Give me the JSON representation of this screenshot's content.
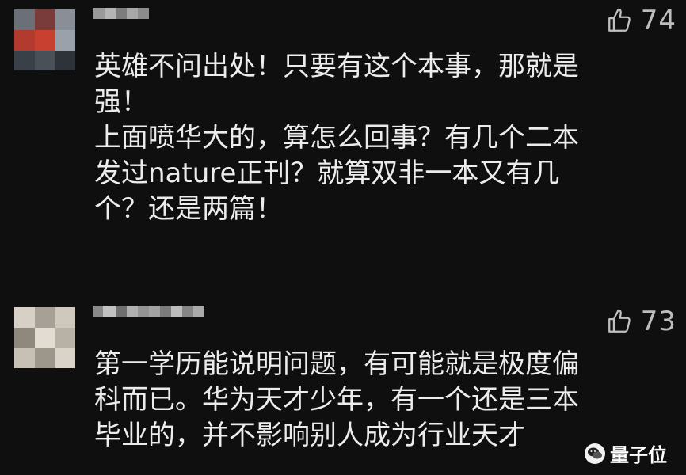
{
  "comments": [
    {
      "likes": "74",
      "lines": [
        "英雄不问出处！只要有这个本事，那就是",
        "强！",
        "上面喷华大的，算怎么回事？有几个二本",
        "发过nature正刊？就算双非一本又有几",
        "个？还是两篇！"
      ]
    },
    {
      "likes": "73",
      "lines": [
        "第一学历能说明问题，有可能就是极度偏",
        "科而已。华为天才少年，有一个还是三本",
        "毕业的，并不影响别人成为行业天才"
      ]
    }
  ],
  "watermark": {
    "label": "量子位"
  },
  "colors": {
    "background": "#0f0f0f",
    "text": "#ececec",
    "meta": "#bdbdbd"
  }
}
